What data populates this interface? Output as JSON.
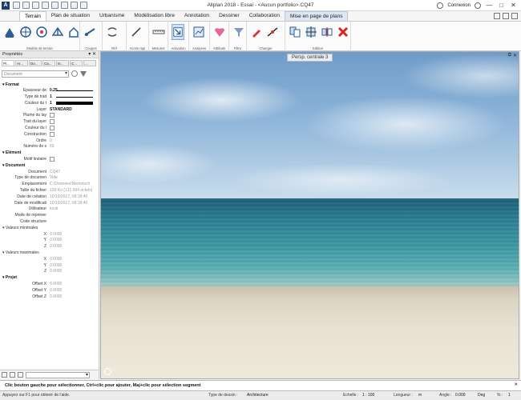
{
  "title": "Allplan 2018 - Essai - <Aucun portfolio>.CQ47",
  "app_logo": "A",
  "account": {
    "label": "Connexion"
  },
  "window_controls": [
    "—",
    "□",
    "✕"
  ],
  "tabs": [
    "Terrain",
    "Plan de situation",
    "Urbanisme",
    "Modélisation libre",
    "Annotation",
    "Dessiner",
    "Collaboration",
    "Mise en page de plans"
  ],
  "ribbon_groups": [
    "Modèle de terrain",
    "Coupes",
    "Réf",
    "Accès rapi",
    "Mesures",
    "Activation",
    "Analyses",
    "Attributs",
    "Filtre",
    "Changer",
    "Edition"
  ],
  "properties": {
    "title": "Propriétés",
    "pin": "▾ ✕",
    "tabs": [
      "Pr...",
      "Ar...",
      "Do...",
      "Ca...",
      "Is...",
      "C...",
      "..."
    ],
    "doc_select": "Document",
    "rows": [
      {
        "type": "section",
        "label": "Format"
      },
      {
        "type": "prop",
        "label": "Epaisseur de",
        "value": "0.25",
        "dark": true,
        "swatch": "line"
      },
      {
        "type": "prop",
        "label": "Type de trait",
        "value": "1",
        "dark": true,
        "swatch": "line"
      },
      {
        "type": "prop",
        "label": "Couleur du t",
        "value": "1",
        "dark": true,
        "swatch": "bar"
      },
      {
        "type": "prop",
        "label": "Layer",
        "value": "STANDARD",
        "dark": true
      },
      {
        "type": "prop",
        "label": "Plume du lay",
        "check": true
      },
      {
        "type": "prop",
        "label": "Trait du layer",
        "check": true
      },
      {
        "type": "prop",
        "label": "Couleur du l",
        "check": true
      },
      {
        "type": "prop",
        "label": "Construction",
        "check": true
      },
      {
        "type": "prop",
        "label": "Ordre",
        "value": "0"
      },
      {
        "type": "prop",
        "label": "Numéro de s",
        "value": "65"
      },
      {
        "type": "section",
        "label": "Elément"
      },
      {
        "type": "prop",
        "label": "Motif linéaire",
        "check": true
      },
      {
        "type": "section",
        "label": "Document"
      },
      {
        "type": "prop",
        "label": "Document",
        "value": "CQ47"
      },
      {
        "type": "prop",
        "label": "Type de documen",
        "value": "Vide"
      },
      {
        "type": "prop",
        "label": "Emplacement",
        "value": "C:\\Données\\Nemetsch"
      },
      {
        "type": "prop",
        "label": "Taille du fichier",
        "value": "128 Ko (131 094 octets)"
      },
      {
        "type": "prop",
        "label": "Date de création",
        "value": "10/10/2017, 09:18:40"
      },
      {
        "type": "prop",
        "label": "Date de modificati",
        "value": "10/10/2017, 09:18:40"
      },
      {
        "type": "prop",
        "label": "Utilisateur",
        "value": "local"
      },
      {
        "type": "prop",
        "label": "Mode de représer",
        "value": ""
      },
      {
        "type": "prop",
        "label": "Code structure",
        "value": ""
      },
      {
        "type": "sub",
        "label": "Valeurs minimales"
      },
      {
        "type": "prop",
        "label": "X",
        "value": "0.0000"
      },
      {
        "type": "prop",
        "label": "Y",
        "value": "0.0000"
      },
      {
        "type": "prop",
        "label": "Z",
        "value": "0.0000"
      },
      {
        "type": "sub",
        "label": "Valeurs maximales"
      },
      {
        "type": "prop",
        "label": "X",
        "value": "0.0000"
      },
      {
        "type": "prop",
        "label": "Y",
        "value": "0.0000"
      },
      {
        "type": "prop",
        "label": "Z",
        "value": "0.0000"
      },
      {
        "type": "section",
        "label": "Projet"
      },
      {
        "type": "prop",
        "label": "Offset X",
        "value": "0.0000"
      },
      {
        "type": "prop",
        "label": "Offset Y",
        "value": "0.0000"
      },
      {
        "type": "prop",
        "label": "Offset Z",
        "value": "0.0000"
      }
    ]
  },
  "viewport": {
    "label": "Persp. centrale 3",
    "controls": [
      "⧉",
      "✕"
    ]
  },
  "prompt": "Clic bouton gauche pour sélectionner, Ctrl+clic pour ajouter, Maj+clic pour sélection segment",
  "prompt_close": "✕",
  "status": {
    "help": "Appuyez sur F1 pour obtenir de l'aide.",
    "drawing_type_label": "Type de dessin :",
    "drawing_type_value": "Architecture",
    "scale_label": "Echelle :",
    "scale_value": "1 : 100",
    "length_label": "Longueur :",
    "length_value": "m",
    "angle_label": "Angle :",
    "angle_value": "0.000",
    "angle_unit": "Deg",
    "percent_label": "% :",
    "percent_value": "1"
  },
  "colors": {
    "accent": "#2a5d9a",
    "ribbon_bg": "#fbfbfb",
    "sea": "#2b7f92",
    "sky": "#8db4d9"
  }
}
